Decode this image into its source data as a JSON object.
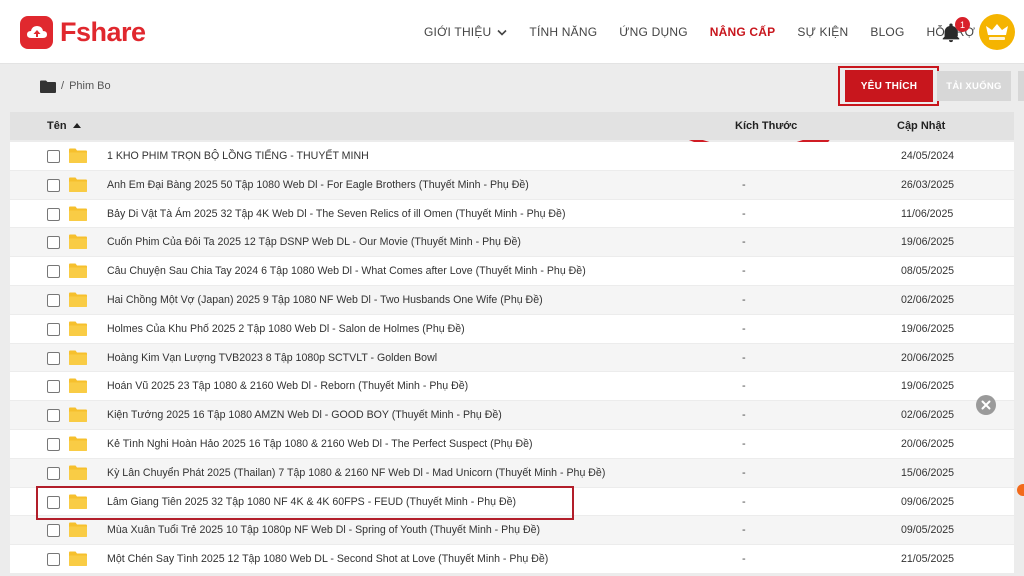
{
  "brand": {
    "name": "Fshare"
  },
  "nav": [
    {
      "label": "GIỚI THIỆU",
      "dropdown": true,
      "active": false
    },
    {
      "label": "TÍNH NĂNG",
      "active": false
    },
    {
      "label": "ỨNG DỤNG",
      "active": false
    },
    {
      "label": "NÂNG CẤP",
      "active": true
    },
    {
      "label": "SỰ KIỆN",
      "active": false
    },
    {
      "label": "BLOG",
      "active": false
    },
    {
      "label": "HỖ TRỢ",
      "active": false
    }
  ],
  "notifications": {
    "count": "1"
  },
  "breadcrumb": {
    "separator": "/",
    "current": "Phim Bo"
  },
  "toolbar": {
    "favorite_label": "YÊU THÍCH",
    "download_label": "TẢI XUỐNG"
  },
  "table": {
    "columns": {
      "name": "Tên",
      "size": "Kích Thước",
      "date": "Cập Nhật"
    },
    "rows": [
      {
        "name": "1 KHO PHIM TRỌN BỘ LỒNG TIẾNG - THUYẾT MINH",
        "size": "",
        "date": "24/05/2024"
      },
      {
        "name": "Anh Em Đại Bàng 2025 50 Tập 1080 Web Dl - For Eagle Brothers (Thuyết Minh - Phụ Đề)",
        "size": "-",
        "date": "26/03/2025"
      },
      {
        "name": "Bảy Di Vật Tà Ám 2025 32 Tập 4K Web Dl - The Seven Relics of ill Omen (Thuyết Minh - Phụ Đề)",
        "size": "-",
        "date": "11/06/2025"
      },
      {
        "name": "Cuốn Phim Của Đôi Ta 2025 12 Tập DSNP Web DL - Our Movie (Thuyết Minh - Phụ Đề)",
        "size": "-",
        "date": "19/06/2025"
      },
      {
        "name": "Câu Chuyện Sau Chia Tay 2024 6 Tập 1080 Web Dl - What Comes after Love (Thuyết Minh - Phụ Đề)",
        "size": "-",
        "date": "08/05/2025"
      },
      {
        "name": "Hai Chồng Một Vợ (Japan) 2025 9 Tập 1080 NF Web Dl - Two Husbands One Wife (Phụ Đề)",
        "size": "-",
        "date": "02/06/2025"
      },
      {
        "name": "Holmes Của Khu Phố 2025 2 Tập 1080 Web Dl - Salon de Holmes (Phụ Đề)",
        "size": "-",
        "date": "19/06/2025"
      },
      {
        "name": "Hoàng Kim Vạn Lượng TVB2023 8 Tập 1080p SCTVLT - Golden Bowl",
        "size": "-",
        "date": "20/06/2025"
      },
      {
        "name": "Hoán Vũ 2025 23 Tập 1080 & 2160 Web Dl - Reborn (Thuyết Minh - Phụ Đề)",
        "size": "-",
        "date": "19/06/2025"
      },
      {
        "name": "Kiện Tướng 2025 16 Tập 1080 AMZN Web Dl - GOOD BOY (Thuyết Minh - Phụ Đề)",
        "size": "-",
        "date": "02/06/2025"
      },
      {
        "name": "Kẻ Tình Nghi Hoàn Hảo 2025 16 Tập 1080 & 2160 Web Dl - The Perfect Suspect (Phụ Đề)",
        "size": "-",
        "date": "20/06/2025"
      },
      {
        "name": "Kỳ Lân Chuyển Phát 2025 (Thailan) 7 Tập 1080 & 2160 NF Web Dl - Mad Unicorn (Thuyết Minh - Phụ Đề)",
        "size": "-",
        "date": "15/06/2025"
      },
      {
        "name": "Lâm Giang Tiên 2025 32 Tập 1080 NF 4K & 4K 60FPS - FEUD (Thuyết Minh - Phụ Đề)",
        "size": "-",
        "date": "09/06/2025"
      },
      {
        "name": "Mùa Xuân Tuổi Trẻ 2025 10 Tập 1080p NF Web Dl - Spring of Youth (Thuyết Minh - Phụ Đề)",
        "size": "-",
        "date": "09/05/2025"
      },
      {
        "name": "Một Chén Say Tình 2025 12 Tập 1080 Web DL - Second Shot at Love (Thuyết Minh - Phụ Đề)",
        "size": "-",
        "date": "21/05/2025"
      }
    ]
  },
  "colors": {
    "brand": "#e0282e",
    "accent": "#c8161d",
    "folder": "#f6c02d",
    "disabled": "#d7d7d7"
  }
}
